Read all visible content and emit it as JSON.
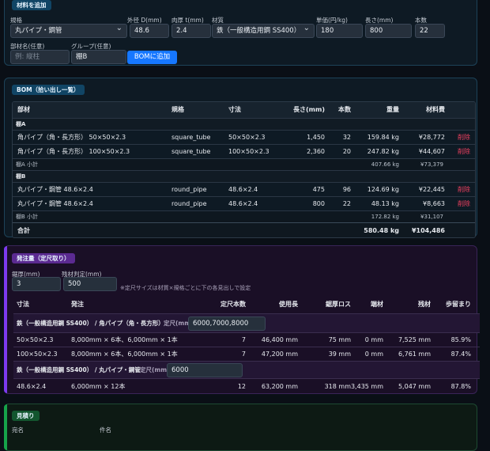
{
  "material_panel": {
    "badge": "材料を追加",
    "labels": {
      "spec": "規格",
      "outer_d": "外径 D(mm)",
      "thickness": "肉厚 t(mm)",
      "material": "材質",
      "unit_price": "単価(円/kg)",
      "length": "長さ(mm)",
      "count": "本数",
      "part_name": "部材名(任意)",
      "group": "グループ(任意)"
    },
    "values": {
      "spec": "丸パイプ・鋼管",
      "outer_d": "48.6",
      "thickness": "2.4",
      "material": "鉄（一般構造用鋼 SS400）",
      "unit_price": "180",
      "length": "800",
      "count": "22",
      "group": "棚B"
    },
    "placeholders": {
      "part_name": "例: 縦柱"
    },
    "add_button": "BOMに追加"
  },
  "bom_panel": {
    "badge": "BOM（拾い出し一覧）",
    "headers": [
      "部材",
      "規格",
      "寸法",
      "長さ(mm)",
      "本数",
      "重量",
      "材料費"
    ],
    "groups": [
      {
        "name": "棚A",
        "rows": [
          {
            "part": "角パイプ（角・長方形） 50×50×2.3",
            "spec": "square_tube",
            "dim": "50×50×2.3",
            "length": "1,450",
            "count": "32",
            "weight": "159.84 kg",
            "cost": "¥28,772",
            "action": "削除"
          },
          {
            "part": "角パイプ（角・長方形） 100×50×2.3",
            "spec": "square_tube",
            "dim": "100×50×2.3",
            "length": "2,360",
            "count": "20",
            "weight": "247.82 kg",
            "cost": "¥44,607",
            "action": "削除"
          }
        ],
        "subtotal_label": "棚A 小計",
        "subtotal_weight": "407.66 kg",
        "subtotal_cost": "¥73,379"
      },
      {
        "name": "棚B",
        "rows": [
          {
            "part": "丸パイプ・鋼管 48.6×2.4",
            "spec": "round_pipe",
            "dim": "48.6×2.4",
            "length": "475",
            "count": "96",
            "weight": "124.69 kg",
            "cost": "¥22,445",
            "action": "削除"
          },
          {
            "part": "丸パイプ・鋼管 48.6×2.4",
            "spec": "round_pipe",
            "dim": "48.6×2.4",
            "length": "800",
            "count": "22",
            "weight": "48.13 kg",
            "cost": "¥8,663",
            "action": "削除"
          }
        ],
        "subtotal_label": "棚B 小計",
        "subtotal_weight": "172.82 kg",
        "subtotal_cost": "¥31,107"
      }
    ],
    "total": {
      "label": "合計",
      "weight": "580.48 kg",
      "cost": "¥104,486"
    }
  },
  "order_panel": {
    "badge": "発注量（定尺取り）",
    "labels": {
      "kerf": "鋸厚(mm)",
      "remnant": "残材判定(mm)"
    },
    "values": {
      "kerf": "3",
      "remnant": "500"
    },
    "note": "※定尺サイズは材質×規格ごとに下の各見出しで設定",
    "headers": [
      "寸法",
      "発注",
      "定尺本数",
      "使用長",
      "鋸厚ロス",
      "端材",
      "残材",
      "歩留まり"
    ],
    "stock_label": "定尺(mm)",
    "groups": [
      {
        "title": "鉄（一般構造用鋼 SS400） / 角パイプ（角・長方形）",
        "stock": "6000,7000,8000",
        "rows": [
          {
            "dim": "50×50×2.3",
            "order": "8,000mm × 6本、6,000mm × 1本",
            "count": "7",
            "used": "46,400 mm",
            "kerf": "75 mm",
            "scrap": "0 mm",
            "remnant": "7,525 mm",
            "yield": "85.9%"
          },
          {
            "dim": "100×50×2.3",
            "order": "8,000mm × 6本、6,000mm × 1本",
            "count": "7",
            "used": "47,200 mm",
            "kerf": "39 mm",
            "scrap": "0 mm",
            "remnant": "6,761 mm",
            "yield": "87.4%"
          }
        ]
      },
      {
        "title": "鉄（一般構造用鋼 SS400） / 丸パイプ・鋼管",
        "stock": "6000",
        "rows": [
          {
            "dim": "48.6×2.4",
            "order": "6,000mm × 12本",
            "count": "12",
            "used": "63,200 mm",
            "kerf": "318 mm",
            "scrap": "3,435 mm",
            "remnant": "5,047 mm",
            "yield": "87.8%"
          }
        ]
      }
    ]
  },
  "estimate_panel": {
    "badge": "見積り",
    "labels": [
      "宛名",
      "件名"
    ]
  }
}
